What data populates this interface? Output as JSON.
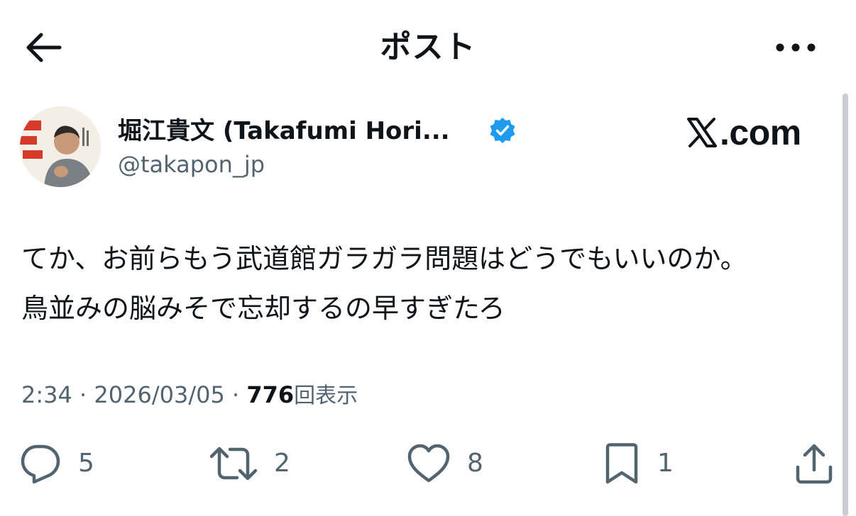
{
  "header": {
    "title": "ポスト",
    "back_icon": "arrow-left-icon",
    "more_icon": "more-horizontal-icon"
  },
  "author": {
    "display_name": "堀江貴文 (Takafumi Hori...",
    "handle": "@takapon_jp",
    "verified": true,
    "verified_color": "#1d9bf0"
  },
  "brand": {
    "logo_text": ".com"
  },
  "post": {
    "text_line1": "てか、お前らもう武道館ガラガラ問題はどうでもいいのか。",
    "text_line2": "鳥並みの脳みそで忘却するの早すぎたろ"
  },
  "meta": {
    "time": "2:34",
    "separator": "·",
    "date": "2026/03/05",
    "views_count": "776",
    "views_label": "回表示"
  },
  "actions": {
    "replies": "5",
    "reposts": "2",
    "likes": "8",
    "bookmarks": "1"
  },
  "colors": {
    "text": "#0f1419",
    "secondary": "#536471",
    "accent": "#1d9bf0"
  }
}
